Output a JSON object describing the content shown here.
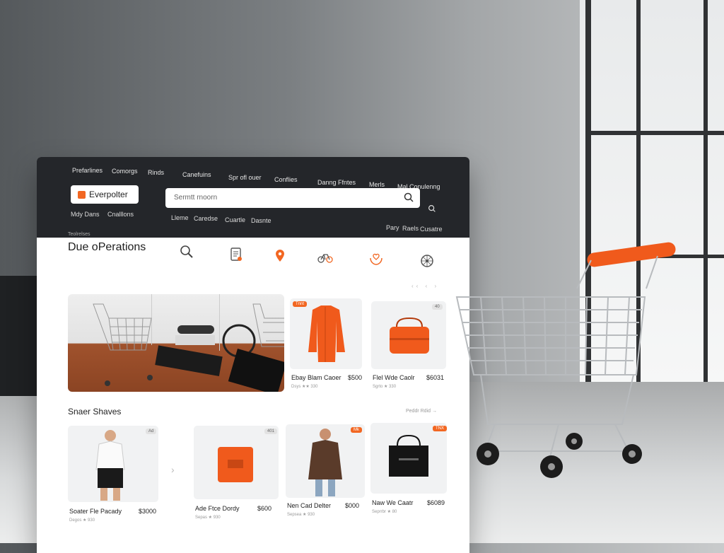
{
  "nav_top": [
    "Prefarlines",
    "Comorgs",
    "Rinds",
    "Canefuins",
    "Spr ofl ouer",
    "Conflies",
    "Danng Ffntes",
    "Merls",
    "Mal Conulenng"
  ],
  "logo": {
    "text": "Everpolter"
  },
  "search": {
    "placeholder": "Sermtt rnoorn"
  },
  "nav_sub_left": [
    "Mdy Dans",
    "Cnalllons"
  ],
  "nav_sub_mid": [
    "Lleme",
    "Caredse",
    "Cuartle",
    "Dasnte"
  ],
  "nav_sub_right": [
    "Pary",
    "Raels",
    "Cusatre"
  ],
  "breadcrumb": "Teolrelses",
  "page_title": "Due oPerations",
  "category_icons": [
    "search-icon",
    "document-icon",
    "location-pin-icon",
    "bicycle-icon",
    "hand-heart-icon",
    "wheel-icon"
  ],
  "pager": "‹‹ ‹ ›",
  "featured_products": [
    {
      "badge": "Tnnt",
      "name": "Ebay Blam Caoer",
      "price": "$500",
      "meta": "Dsys ★★ 330"
    },
    {
      "badge": "40",
      "name": "Flel Wde Caolr",
      "price": "$6031",
      "meta": "Sgrto ★ 330"
    }
  ],
  "section": {
    "title": "Snaer Shaves",
    "more": "Peddr Rdid →"
  },
  "products": [
    {
      "badge": "Ad",
      "name": "Soater Fle Pacady",
      "price": "$3000",
      "meta": "Degos ★ 930"
    },
    {
      "badge": "401",
      "name": "Ade Ftce Dordy",
      "price": "$600",
      "meta": "Sepas ★ 930"
    },
    {
      "badge": "Mk",
      "name": "Nen Cad Delter",
      "price": "$000",
      "meta": "Sepsea ★ 930"
    },
    {
      "badge": "TNX",
      "name": "Naw We Caatr",
      "price": "$6089",
      "meta": "Seprrbr ★ 80"
    }
  ],
  "colors": {
    "accent": "#f26722",
    "topbar": "#24262a",
    "panel": "#ffffff"
  }
}
